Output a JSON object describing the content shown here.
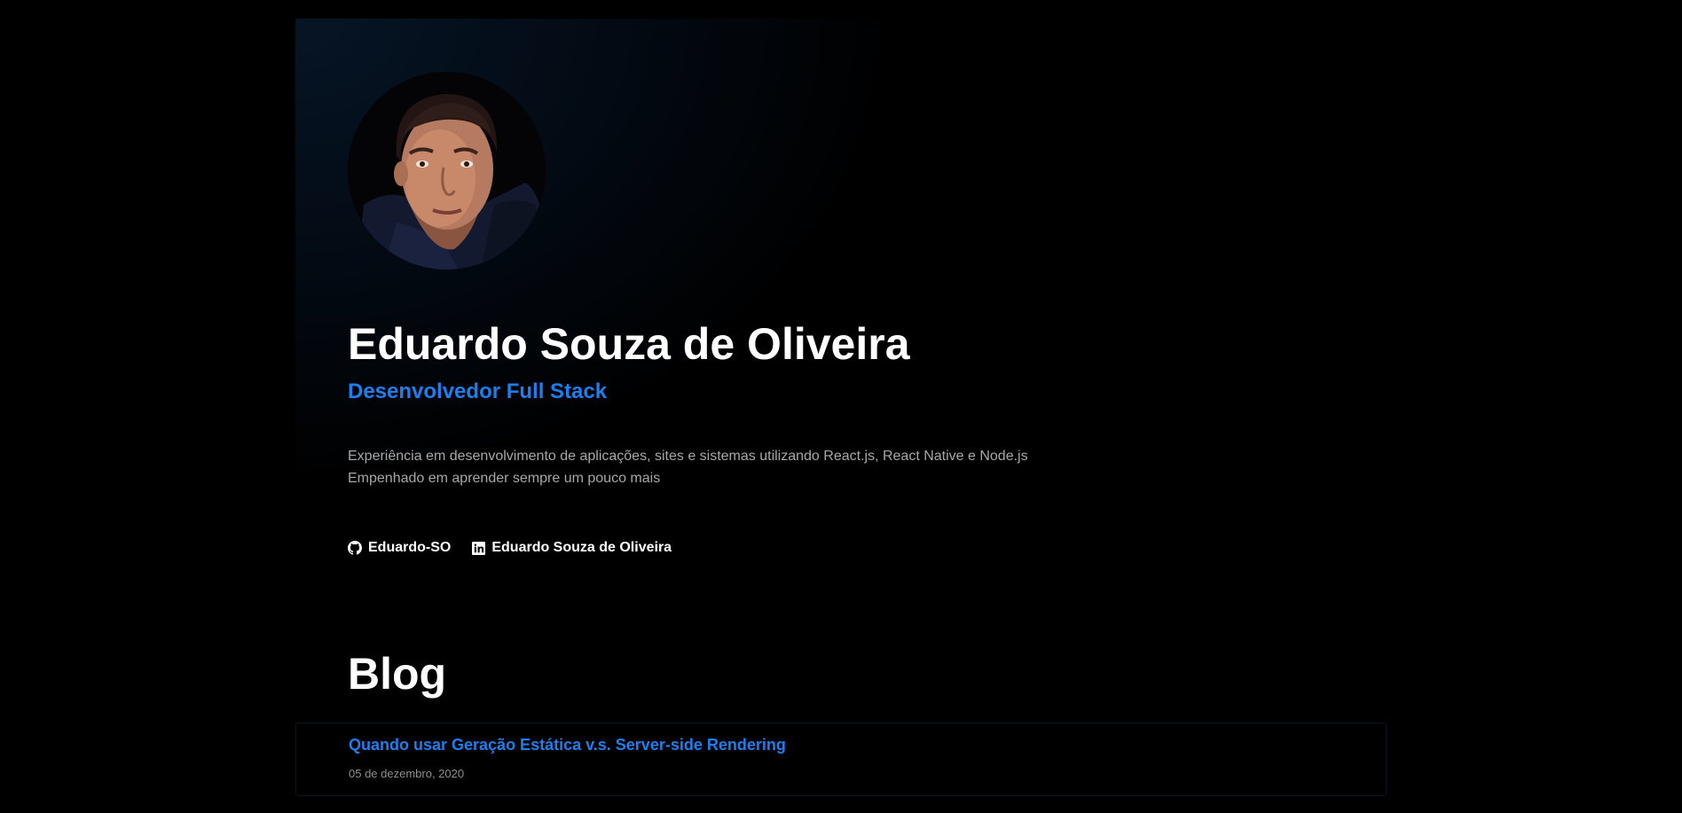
{
  "profile": {
    "avatar_alt": "Eduardo Souza de Oliveira",
    "name": "Eduardo Souza de Oliveira",
    "role": "Desenvolvedor Full Stack",
    "bio_line1": "Experiência em desenvolvimento de aplicações, sites e sistemas utilizando React.js, React Native e Node.js",
    "bio_line2": "Empenhado em aprender sempre um pouco mais"
  },
  "socials": [
    {
      "icon": "github-icon",
      "label": "Eduardo-SO"
    },
    {
      "icon": "linkedin-icon",
      "label": "Eduardo Souza de Oliveira"
    }
  ],
  "blog": {
    "title": "Blog",
    "posts": [
      {
        "title": "Quando usar Geração Estática v.s. Server-side Rendering",
        "date": "05 de dezembro, 2020"
      }
    ]
  },
  "colors": {
    "background": "#000000",
    "accent": "#1a7ff0",
    "text_primary": "#ffffff",
    "text_secondary": "#a7a7a7",
    "hero_gradient_start": "#061526"
  }
}
